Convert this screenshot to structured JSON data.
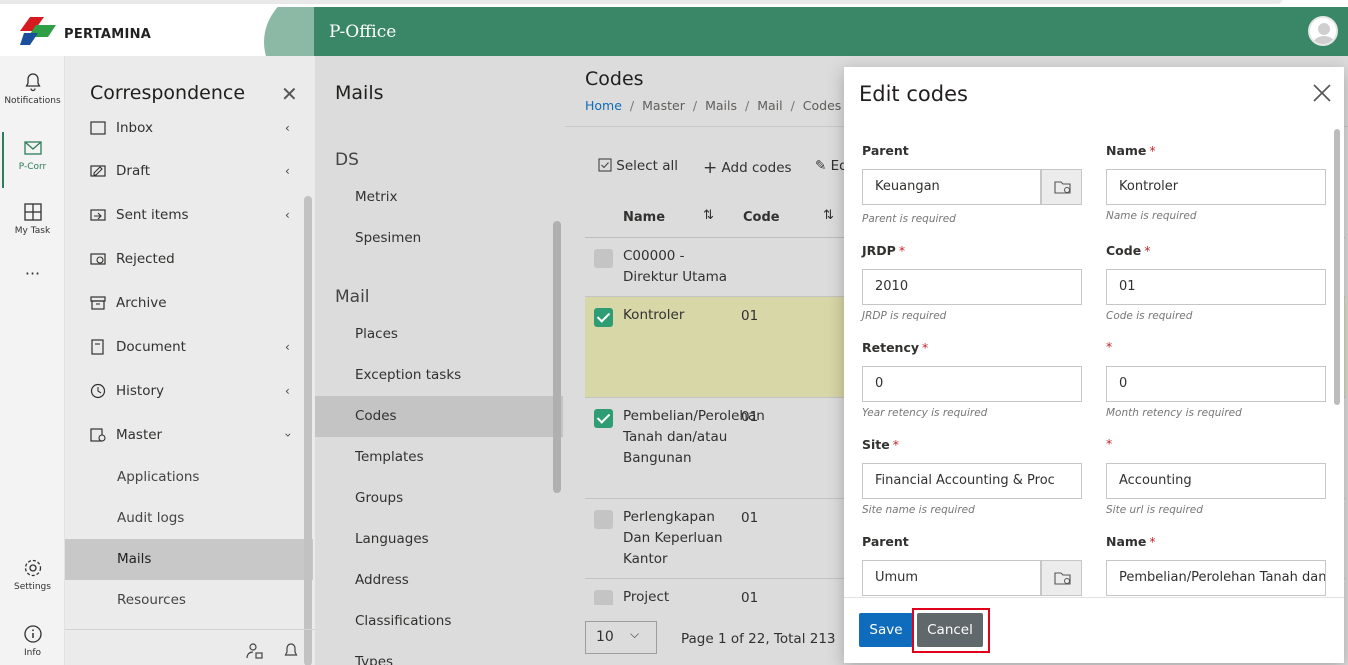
{
  "app": {
    "brand": "PERTAMINA",
    "title": "P-Office"
  },
  "rail": {
    "items": [
      {
        "label": "Notifications",
        "icon": "bell-icon"
      },
      {
        "label": "P-Corr",
        "icon": "mail-icon"
      },
      {
        "label": "My Task",
        "icon": "grid-icon"
      },
      {
        "label": "···",
        "icon": "more-icon"
      },
      {
        "label": "Settings",
        "icon": "gear-icon"
      },
      {
        "label": "Info",
        "icon": "info-icon"
      }
    ]
  },
  "corr": {
    "title": "Correspondence",
    "items": [
      {
        "label": "Inbox"
      },
      {
        "label": "Draft"
      },
      {
        "label": "Sent items"
      },
      {
        "label": "Rejected"
      },
      {
        "label": "Archive"
      },
      {
        "label": "Document"
      },
      {
        "label": "History"
      },
      {
        "label": "Master"
      }
    ],
    "sub_items": [
      {
        "label": "Applications"
      },
      {
        "label": "Audit logs"
      },
      {
        "label": "Mails"
      },
      {
        "label": "Resources"
      }
    ]
  },
  "mails": {
    "title": "Mails",
    "group_ds": "DS",
    "ds_items": [
      {
        "label": "Metrix"
      },
      {
        "label": "Spesimen"
      }
    ],
    "group_mail": "Mail",
    "mail_items": [
      {
        "label": "Places"
      },
      {
        "label": "Exception tasks"
      },
      {
        "label": "Codes"
      },
      {
        "label": "Templates"
      },
      {
        "label": "Groups"
      },
      {
        "label": "Languages"
      },
      {
        "label": "Address"
      },
      {
        "label": "Classifications"
      },
      {
        "label": "Types"
      }
    ]
  },
  "codes": {
    "title": "Codes",
    "breadcrumb": [
      "Home",
      "Master",
      "Mails",
      "Mail",
      "Codes"
    ],
    "toolbar": {
      "select_all": "Select all",
      "add": "Add codes",
      "edit": "Ed"
    },
    "columns": {
      "name": "Name",
      "code": "Code"
    },
    "rows": [
      {
        "name": "C00000 - Direktur Utama",
        "code": "",
        "checked": false
      },
      {
        "name": "Kontroler",
        "code": "01",
        "checked": true
      },
      {
        "name": "Pembelian/Perolehan Tanah dan/atau Bangunan",
        "code": "01",
        "checked": true
      },
      {
        "name": "Perlengkapan Dan Keperluan Kantor",
        "code": "01",
        "checked": false
      },
      {
        "name": "Project",
        "code": "01",
        "checked": false
      }
    ],
    "page_size": "10",
    "page_info": "Page 1 of 22, Total 213"
  },
  "modal": {
    "title": "Edit codes",
    "fields": {
      "parent1_label": "Parent",
      "parent1_value": "Keuangan",
      "parent1_hint": "Parent is required",
      "name1_label": "Name",
      "name1_value": "Kontroler",
      "name1_hint": "Name is required",
      "jrdp_label": "JRDP",
      "jrdp_value": "2010",
      "jrdp_hint": "JRDP is required",
      "code_label": "Code",
      "code_value": "01",
      "code_hint": "Code is required",
      "retency_label": "Retency",
      "retency_year_value": "0",
      "retency_year_hint": "Year retency is required",
      "retency_month_value": "0",
      "retency_month_hint": "Month retency is required",
      "site_label": "Site",
      "site_name_value": "Financial Accounting & Proc",
      "site_name_hint": "Site name is required",
      "site_url_value": "Accounting",
      "site_url_hint": "Site url is required",
      "parent2_label": "Parent",
      "parent2_value": "Umum",
      "name2_label": "Name",
      "name2_value": "Pembelian/Perolehan Tanah dan/atau Bangunan"
    },
    "required_mark": "*",
    "save_label": "Save",
    "cancel_label": "Cancel"
  },
  "colors": {
    "brand_green": "#3a8767",
    "accent_blue": "#0f6cbd",
    "highlight_red": "#e0001a"
  }
}
